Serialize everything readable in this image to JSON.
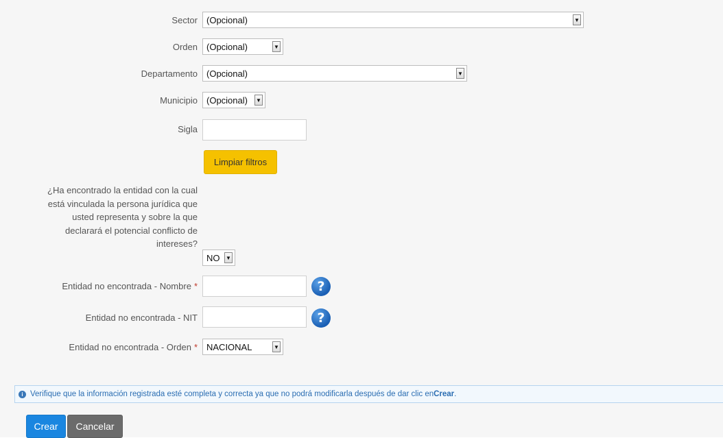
{
  "form": {
    "sector": {
      "label": "Sector",
      "value": "(Opcional)"
    },
    "orden": {
      "label": "Orden",
      "value": "(Opcional)"
    },
    "departamento": {
      "label": "Departamento",
      "value": "(Opcional)"
    },
    "municipio": {
      "label": "Municipio",
      "value": "(Opcional)"
    },
    "sigla": {
      "label": "Sigla",
      "value": ""
    },
    "clear_filters_label": "Limpiar filtros",
    "question": {
      "lines": [
        "¿Ha encontrado la entidad con la cual",
        "está vinculada la persona jurídica que",
        "usted representa y sobre la que",
        "declarará el potencial conflicto de",
        "intereses?"
      ],
      "value": "NO"
    },
    "entity_name": {
      "label": "Entidad no encontrada - Nombre",
      "required_mark": "*",
      "value": ""
    },
    "entity_nit": {
      "label": "Entidad no encontrada - NIT",
      "value": ""
    },
    "entity_order": {
      "label": "Entidad no encontrada - Orden",
      "required_mark": "*",
      "value": "NACIONAL"
    }
  },
  "alert": {
    "text": "Verifique que la información registrada esté completa y correcta ya que no podrá modificarla después de dar clic en ",
    "emphasis": "Crear",
    "suffix": "."
  },
  "actions": {
    "create_label": "Crear",
    "cancel_label": "Cancelar"
  },
  "colors": {
    "primary": "#1a86e0",
    "warning": "#f5c100",
    "help_icon": "#1a5fb4"
  }
}
